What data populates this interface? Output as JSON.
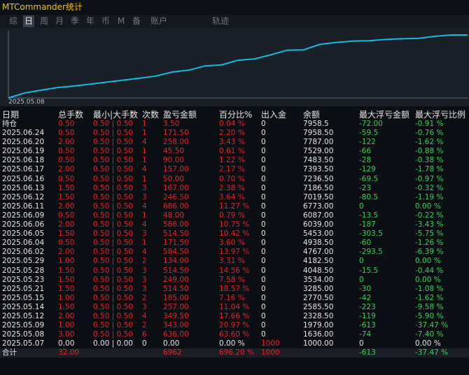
{
  "app": {
    "title": "MTCommander统计"
  },
  "tabs": [
    {
      "label": "综",
      "active": false
    },
    {
      "label": "日",
      "active": true
    },
    {
      "label": "周",
      "active": false
    },
    {
      "label": "月",
      "active": false
    },
    {
      "label": "季",
      "active": false
    },
    {
      "label": "年",
      "active": false
    },
    {
      "label": "币",
      "active": false
    },
    {
      "label": "M",
      "active": false
    },
    {
      "label": "备",
      "active": false
    },
    {
      "label": "账户",
      "active": false
    },
    {
      "label": "轨迹",
      "active": false
    }
  ],
  "chart_data": {
    "type": "line",
    "x_start_label": "2025.05.08",
    "line_color": "#18b8e8",
    "series": [
      {
        "values": [
          0,
          636,
          979,
          1322,
          1507,
          1750,
          1999,
          2250,
          2507,
          2764,
          3279,
          3514,
          4048,
          4182,
          4767,
          4938,
          5453,
          6039,
          6087,
          6773,
          7020,
          7186,
          7237,
          7393,
          7483,
          7529,
          7787,
          7958,
          7959
        ]
      }
    ]
  },
  "table": {
    "headers": [
      "日期",
      "总手数",
      "最小|大手数",
      "次数",
      "盈亏金额",
      "百分比%",
      "出入金",
      "余额",
      "最大浮亏金额",
      "最大浮亏比例"
    ],
    "holding_label": "持仓",
    "rows": [
      {
        "date": "2025.06.24",
        "lots": "0.50",
        "minmax": "0.50 | 0.50",
        "count": "1",
        "pnl": "171.50",
        "pct": "2.20 %",
        "io": "0",
        "balance": "7958.50",
        "ddamt": "-59.5",
        "ddpct": "-0.76 %"
      },
      {
        "date": "2025.06.20",
        "lots": "2.00",
        "minmax": "0.50 | 0.50",
        "count": "4",
        "pnl": "258.00",
        "pct": "3.43 %",
        "io": "0",
        "balance": "7787.00",
        "ddamt": "-122",
        "ddpct": "-1.62 %"
      },
      {
        "date": "2025.06.19",
        "lots": "0.50",
        "minmax": "0.50 | 0.50",
        "count": "1",
        "pnl": "45.50",
        "pct": "0.61 %",
        "io": "0",
        "balance": "7529.00",
        "ddamt": "-66",
        "ddpct": "-0.88 %"
      },
      {
        "date": "2025.06.18",
        "lots": "0.50",
        "minmax": "0.50 | 0.50",
        "count": "1",
        "pnl": "90.00",
        "pct": "1.22 %",
        "io": "0",
        "balance": "7483.50",
        "ddamt": "-28",
        "ddpct": "-0.38 %"
      },
      {
        "date": "2025.06.17",
        "lots": "2.00",
        "minmax": "0.50 | 0.50",
        "count": "4",
        "pnl": "157.00",
        "pct": "2.17 %",
        "io": "0",
        "balance": "7393.50",
        "ddamt": "-129",
        "ddpct": "-1.78 %"
      },
      {
        "date": "2025.06.16",
        "lots": "0.50",
        "minmax": "0.50 | 0.50",
        "count": "1",
        "pnl": "50.00",
        "pct": "0.70 %",
        "io": "0",
        "balance": "7236.50",
        "ddamt": "-69.5",
        "ddpct": "-0.97 %"
      },
      {
        "date": "2025.06.13",
        "lots": "1.50",
        "minmax": "0.50 | 0.50",
        "count": "3",
        "pnl": "167.00",
        "pct": "2.38 %",
        "io": "0",
        "balance": "7186.50",
        "ddamt": "-23",
        "ddpct": "-0.32 %"
      },
      {
        "date": "2025.06.12",
        "lots": "1.50",
        "minmax": "0.50 | 0.50",
        "count": "3",
        "pnl": "246.50",
        "pct": "3.64 %",
        "io": "0",
        "balance": "7019.50",
        "ddamt": "-80.5",
        "ddpct": "-1.19 %"
      },
      {
        "date": "2025.06.11",
        "lots": "2.00",
        "minmax": "0.50 | 0.50",
        "count": "4",
        "pnl": "686.00",
        "pct": "11.27 %",
        "io": "0",
        "balance": "6773.00",
        "ddamt": "0",
        "ddpct": "0.00 %"
      },
      {
        "date": "2025.06.09",
        "lots": "0.50",
        "minmax": "0.50 | 0.50",
        "count": "1",
        "pnl": "48.00",
        "pct": "0.79 %",
        "io": "0",
        "balance": "6087.00",
        "ddamt": "-13.5",
        "ddpct": "-0.22 %"
      },
      {
        "date": "2025.06.06",
        "lots": "2.00",
        "minmax": "0.50 | 0.50",
        "count": "4",
        "pnl": "586.00",
        "pct": "10.75 %",
        "io": "0",
        "balance": "6039.00",
        "ddamt": "-187",
        "ddpct": "-3.43 %"
      },
      {
        "date": "2025.06.05",
        "lots": "1.50",
        "minmax": "0.50 | 0.50",
        "count": "3",
        "pnl": "514.50",
        "pct": "10.42 %",
        "io": "0",
        "balance": "5453.00",
        "ddamt": "-303.5",
        "ddpct": "-5.75 %"
      },
      {
        "date": "2025.06.04",
        "lots": "0.50",
        "minmax": "0.50 | 0.50",
        "count": "1",
        "pnl": "171.50",
        "pct": "3.60 %",
        "io": "0",
        "balance": "4938.50",
        "ddamt": "-60",
        "ddpct": "-1.26 %"
      },
      {
        "date": "2025.06.02",
        "lots": "2.00",
        "minmax": "0.50 | 0.50",
        "count": "4",
        "pnl": "584.50",
        "pct": "13.97 %",
        "io": "0",
        "balance": "4767.00",
        "ddamt": "-293.5",
        "ddpct": "-6.39 %"
      },
      {
        "date": "2025.05.29",
        "lots": "1.00",
        "minmax": "0.50 | 0.50",
        "count": "2",
        "pnl": "134.00",
        "pct": "3.31 %",
        "io": "0",
        "balance": "4182.50",
        "ddamt": "0",
        "ddpct": "0.00 %"
      },
      {
        "date": "2025.05.28",
        "lots": "1.50",
        "minmax": "0.50 | 0.50",
        "count": "3",
        "pnl": "514.50",
        "pct": "14.56 %",
        "io": "0",
        "balance": "4048.50",
        "ddamt": "-15.5",
        "ddpct": "-0.44 %"
      },
      {
        "date": "2025.05.23",
        "lots": "1.50",
        "minmax": "0.50 | 0.50",
        "count": "3",
        "pnl": "249.00",
        "pct": "7.58 %",
        "io": "0",
        "balance": "3534.00",
        "ddamt": "0",
        "ddpct": "0.00 %"
      },
      {
        "date": "2025.05.21",
        "lots": "1.50",
        "minmax": "0.50 | 0.50",
        "count": "3",
        "pnl": "514.50",
        "pct": "18.57 %",
        "io": "0",
        "balance": "3285.00",
        "ddamt": "-30",
        "ddpct": "-1.08 %"
      },
      {
        "date": "2025.05.15",
        "lots": "1.00",
        "minmax": "0.50 | 0.50",
        "count": "2",
        "pnl": "185.00",
        "pct": "7.16 %",
        "io": "0",
        "balance": "2770.50",
        "ddamt": "-42",
        "ddpct": "-1.62 %"
      },
      {
        "date": "2025.05.14",
        "lots": "1.50",
        "minmax": "0.50 | 0.50",
        "count": "3",
        "pnl": "257.00",
        "pct": "11.04 %",
        "io": "0",
        "balance": "2585.50",
        "ddamt": "-223",
        "ddpct": "-9.58 %"
      },
      {
        "date": "2025.05.12",
        "lots": "2.00",
        "minmax": "0.50 | 0.50",
        "count": "4",
        "pnl": "349.50",
        "pct": "17.66 %",
        "io": "0",
        "balance": "2328.50",
        "ddamt": "-119",
        "ddpct": "-5.90 %"
      },
      {
        "date": "2025.05.09",
        "lots": "1.00",
        "minmax": "0.50 | 0.50",
        "count": "2",
        "pnl": "343.00",
        "pct": "20.97 %",
        "io": "0",
        "balance": "1979.00",
        "ddamt": "-613",
        "ddpct": "-37.47 %"
      },
      {
        "date": "2025.05.08",
        "lots": "3.00",
        "minmax": "0.50 | 0.50",
        "count": "6",
        "pnl": "636.00",
        "pct": "63.60 %",
        "io": "0",
        "balance": "1636.00",
        "ddamt": "-74",
        "ddpct": "-7.40 %"
      },
      {
        "date": "2025.05.07",
        "lots": "0.00",
        "minmax": "0.00 | 0.00",
        "count": "0",
        "pnl": "0.00",
        "pct": "0.00 %",
        "io": "1000",
        "balance": "1000.00",
        "ddamt": "0",
        "ddpct": "0.00 %",
        "white": true
      }
    ],
    "holding": {
      "lots": "0.50",
      "minmax": "0.50 | 0.50",
      "count": "1",
      "pnl": "3.50",
      "pct": "0.04 %",
      "io": "0",
      "balance": "7958.5",
      "ddamt": "-72.00",
      "ddpct": "-0.91 %"
    },
    "total": {
      "label": "合计",
      "lots": "32.00",
      "pnl": "6962",
      "pct": "696.20 %",
      "io": "1000",
      "ddamt": "-613",
      "ddpct": "-37.47 %"
    }
  }
}
